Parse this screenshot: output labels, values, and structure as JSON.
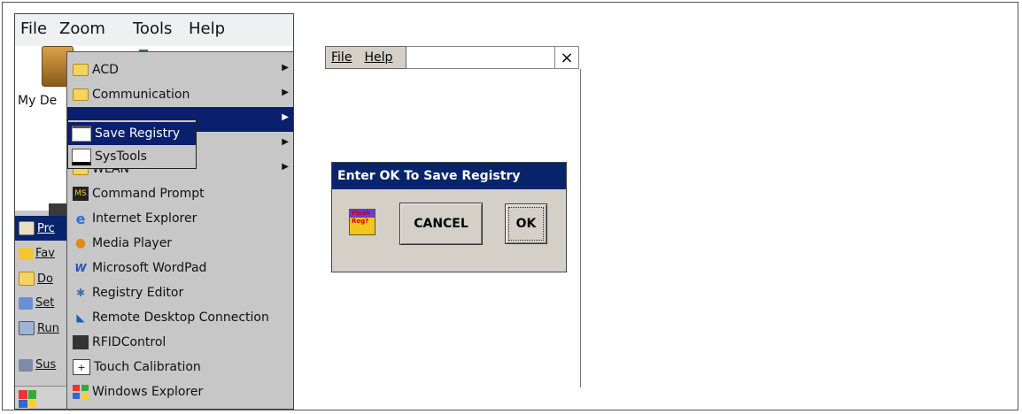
{
  "device": {
    "menubar": [
      "File",
      "Zoom",
      "Tools",
      "Help"
    ],
    "desktop_label": "My De",
    "taskbar_items": [
      {
        "label": "Prc",
        "icon": "programs-icon"
      },
      {
        "label": "Fav",
        "icon": "favorites-icon"
      },
      {
        "label": "Do",
        "icon": "documents-icon"
      },
      {
        "label": "Set",
        "icon": "settings-icon"
      },
      {
        "label": "Run",
        "icon": "run-icon"
      },
      {
        "label": "Sus",
        "icon": "suspend-icon"
      }
    ],
    "programs_menu": [
      {
        "label": "ACD",
        "icon": "folder-icon",
        "submenu": true
      },
      {
        "label": "Communication",
        "icon": "folder-icon",
        "submenu": true
      },
      {
        "label": "",
        "icon": "",
        "submenu": true,
        "highlighted": true
      },
      {
        "label": "",
        "icon": "",
        "submenu": true
      },
      {
        "label": "WLAN",
        "icon": "folder-icon",
        "submenu": true
      },
      {
        "label": "Command Prompt",
        "icon": "command-prompt-icon"
      },
      {
        "label": "Internet Explorer",
        "icon": "internet-explorer-icon"
      },
      {
        "label": "Media Player",
        "icon": "media-player-icon"
      },
      {
        "label": "Microsoft WordPad",
        "icon": "wordpad-icon"
      },
      {
        "label": "Registry Editor",
        "icon": "registry-editor-icon"
      },
      {
        "label": "Remote Desktop Connection",
        "icon": "remote-desktop-icon"
      },
      {
        "label": "RFIDControl",
        "icon": "rfid-icon"
      },
      {
        "label": "Touch Calibration",
        "icon": "touch-calibration-icon"
      },
      {
        "label": "Windows Explorer",
        "icon": "windows-explorer-icon"
      }
    ],
    "submenu": [
      {
        "label": "Save Registry",
        "icon": "window-icon",
        "highlighted": true
      },
      {
        "label": "SysTools",
        "icon": "systools-icon"
      }
    ]
  },
  "window": {
    "menu": {
      "file": "File",
      "help": "Help"
    },
    "close": "×"
  },
  "dialog": {
    "title": "Enter OK To Save Registry",
    "icon_text_1": "Flush",
    "icon_text_2": "Reg?",
    "cancel": "CANCEL",
    "ok": "OK"
  },
  "colors": {
    "highlight": "#0a1f6e",
    "titlebar": "#08246b",
    "menu_bg": "#c7c7c7",
    "dialog_bg": "#d4d0c8"
  }
}
